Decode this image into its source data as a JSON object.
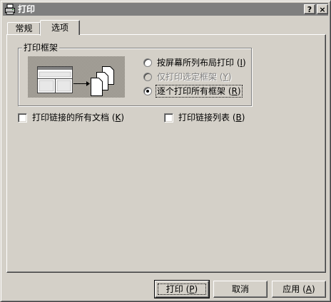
{
  "window": {
    "title": "打印",
    "help_label": "?",
    "close_label": "×",
    "icon": "printer-icon"
  },
  "tabs": [
    {
      "label": "常规",
      "selected": false
    },
    {
      "label": "选项",
      "selected": true
    }
  ],
  "print_frames": {
    "group_label": "打印框架",
    "options": [
      {
        "label": "按屏幕所列布局打印 (",
        "hotkey": "I",
        "suffix": ")",
        "selected": false,
        "enabled": true
      },
      {
        "label": "仅打印选定框架 (",
        "hotkey": "Y",
        "suffix": ")",
        "selected": false,
        "enabled": false
      },
      {
        "label": "逐个打印所有框架 (",
        "hotkey": "R",
        "suffix": ")",
        "selected": true,
        "enabled": true
      }
    ]
  },
  "checkboxes": {
    "print_all_linked": {
      "label": "打印链接的所有文档 (",
      "hotkey": "K",
      "suffix": ")",
      "checked": false
    },
    "print_link_table": {
      "label": "打印链接列表 (",
      "hotkey": "B",
      "suffix": ")",
      "checked": false
    }
  },
  "buttons": {
    "print": {
      "label": "打印 (",
      "hotkey": "P",
      "suffix": ")"
    },
    "cancel": {
      "label": "取消"
    },
    "apply": {
      "label": "应用 (",
      "hotkey": "A",
      "suffix": ")"
    }
  },
  "colors": {
    "face": "#d4d0c8",
    "titlebar": "#7f7f7f",
    "title_text": "#ffffff",
    "disabled_text": "#808080"
  }
}
